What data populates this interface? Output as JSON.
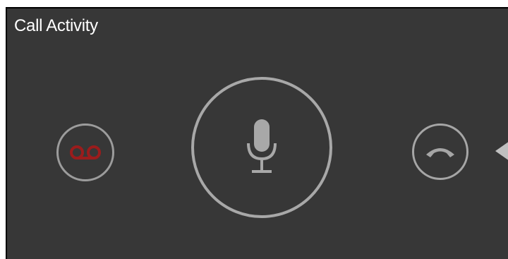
{
  "window": {
    "title": "Call Activity"
  },
  "controls": {
    "voicemail": {
      "icon": "voicemail-icon",
      "color": "#9b1c1c"
    },
    "microphone": {
      "icon": "microphone-icon",
      "color": "#a8a8a8"
    },
    "hangup": {
      "icon": "hang-up-icon",
      "color": "#a6a6a6"
    },
    "expand": {
      "icon": "chevron-left-icon"
    }
  },
  "colors": {
    "background": "#373737",
    "title": "#ffffff",
    "ring": "#a6a6a6"
  }
}
